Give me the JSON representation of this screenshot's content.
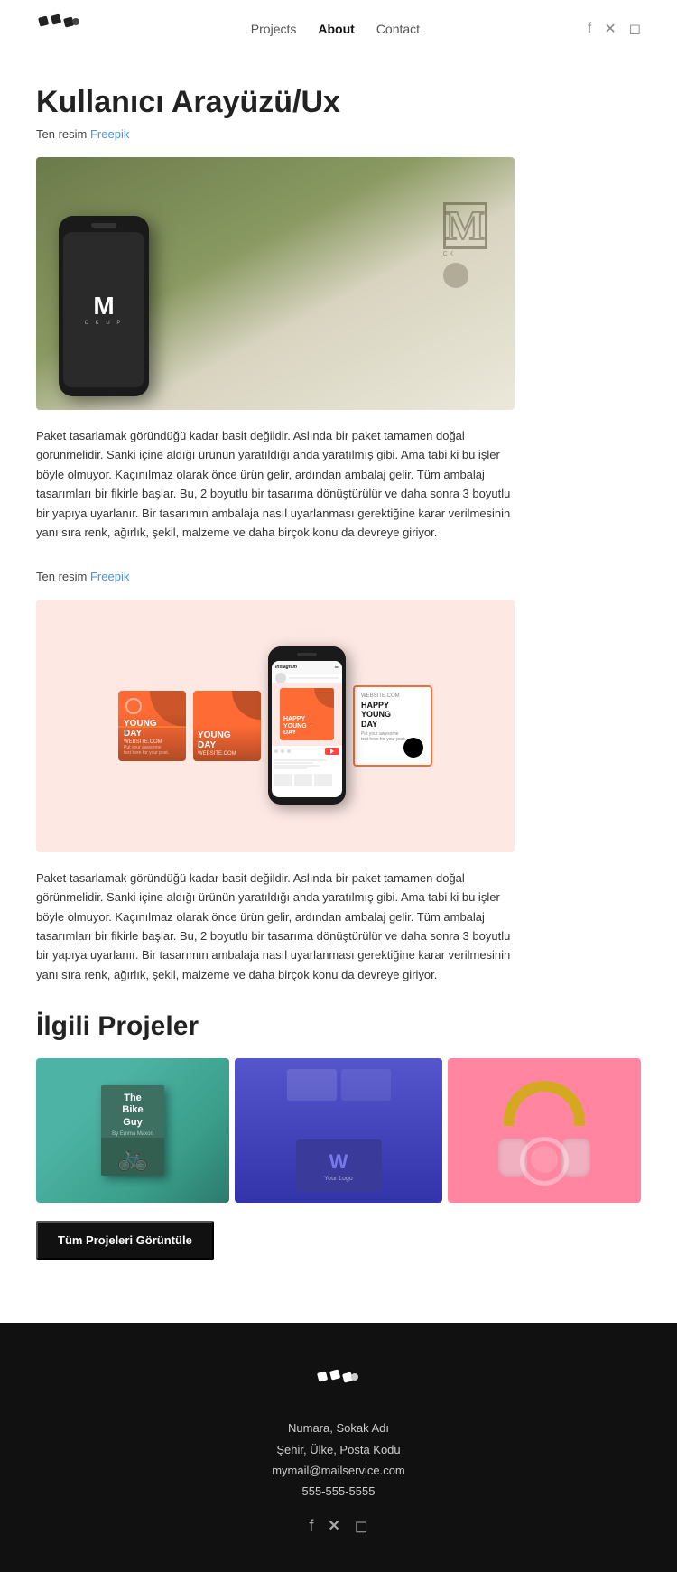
{
  "site": {
    "logo_alt": "Logo"
  },
  "header": {
    "nav": {
      "projects": "Projects",
      "about": "About",
      "contact": "Contact"
    },
    "active_nav": "About"
  },
  "page": {
    "title": "Kullanıcı Arayüzü/Ux",
    "credit_prefix": "Ten resim",
    "credit_link_text": "Freepik",
    "description_1": "Paket tasarlamak göründüğü kadar basit değildir. Aslında bir paket tamamen doğal görünmelidir. Sanki içine aldığı ürünün yaratıldığı anda yaratılmış gibi. Ama tabi ki bu işler böyle olmuyor. Kaçınılmaz olarak önce ürün gelir, ardından ambalaj gelir. Tüm ambalaj tasarımları bir fikirle başlar. Bu, 2 boyutlu bir tasarıma dönüştürülür ve daha sonra 3 boyutlu bir yapıya uyarlanır. Bir tasarımın ambalaja nasıl uyarlanması gerektiğine karar verilmesinin yanı sıra renk, ağırlık, şekil, malzeme ve daha birçok konu da devreye giriyor.",
    "description_2": "Paket tasarlamak göründüğü kadar basit değildir. Aslında bir paket tamamen doğal görünmelidir. Sanki içine aldığı ürünün yaratıldığı anda yaratılmış gibi. Ama tabi ki bu işler böyle olmuyor. Kaçınılmaz olarak önce ürün gelir, ardından ambalaj gelir. Tüm ambalaj tasarımları bir fikirle başlar. Bu, 2 boyutlu bir tasarıma dönüştürülür ve daha sonra 3 boyutlu bir yapıya uyarlanır. Bir tasarımın ambalaja nasıl uyarlanması gerektiğine karar verilmesinin yanı sıra renk, ağırlık, şekil, malzeme ve daha birçok konu da devreye giriyor.",
    "credit_prefix_2": "Ten resim",
    "credit_link_text_2": "Freepik"
  },
  "related": {
    "title": "İlgili Projeler",
    "view_all_button": "Tüm Projeleri Görüntüle",
    "projects": [
      {
        "name": "The Bike Guy",
        "author": "By Emma Maxon"
      },
      {
        "name": "Logo Design",
        "label": "Your Logo"
      },
      {
        "name": "Headphones Pink"
      }
    ]
  },
  "footer": {
    "address_line1": "Numara, Sokak Adı",
    "address_line2": "Şehir, Ülke, Posta Kodu",
    "email": "mymail@mailservice.com",
    "phone": "555-555-5555"
  }
}
